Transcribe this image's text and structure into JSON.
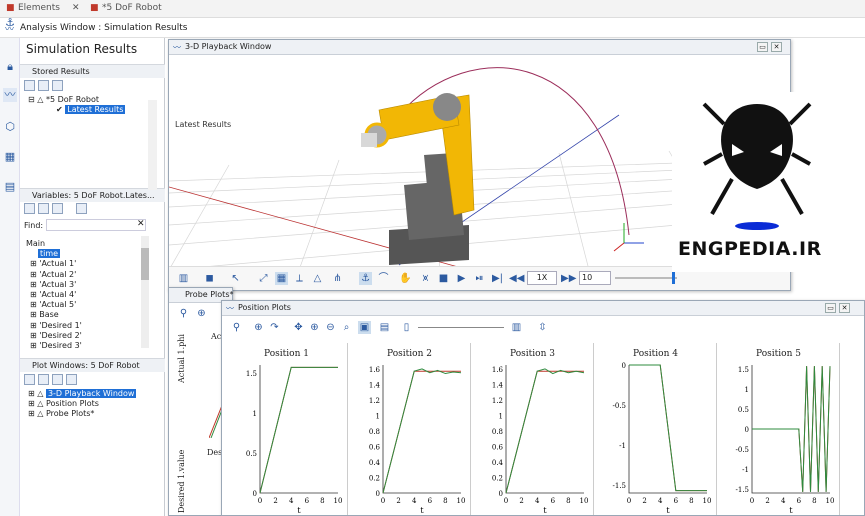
{
  "app": {
    "tab1": "Elements",
    "tab2": "*5 DoF Robot",
    "breadcrumb": "Analysis Window : Simulation Results"
  },
  "left": {
    "title": "Simulation Results",
    "stored_header": "Stored Results",
    "stored_tree": [
      "*5 DoF Robot",
      "Latest Results"
    ],
    "variables_header": "Variables: 5 DoF Robot.Lates...",
    "find_label": "Find:",
    "var_tree": [
      "Main",
      "time",
      "'Actual 1'",
      "'Actual 2'",
      "'Actual 3'",
      "'Actual 4'",
      "'Actual 5'",
      "Base",
      "'Desired 1'",
      "'Desired 2'",
      "'Desired 3'"
    ],
    "plotwin_header": "Plot Windows: 5 DoF Robot",
    "plotwin_tree": [
      "3-D Playback Window",
      "Position Plots",
      "Probe Plots*"
    ]
  },
  "playback": {
    "title": "3-D Playback Window",
    "scene_label": "Latest Results",
    "speed": "1X",
    "frame": "10",
    "frame_fraction": 0.94
  },
  "probe": {
    "title": "Probe Plots*",
    "labels": [
      "Ac",
      "Actual 1.phi",
      "Des",
      "Desired 1.value"
    ]
  },
  "position": {
    "title": "Position Plots"
  },
  "logo": {
    "text": "ENGPEDIA.IR"
  },
  "plots": [
    {
      "title": "Position 1",
      "yticks": [
        "1.5",
        "1",
        "0.5",
        "0"
      ],
      "xticks": [
        "0",
        "2",
        "4",
        "6",
        "8",
        "10"
      ],
      "xlabel": "t"
    },
    {
      "title": "Position 2",
      "yticks": [
        "1.6",
        "1.4",
        "1.2",
        "1",
        "0.8",
        "0.6",
        "0.4",
        "0.2",
        "0"
      ],
      "xticks": [
        "0",
        "2",
        "4",
        "6",
        "8",
        "10"
      ],
      "xlabel": "t"
    },
    {
      "title": "Position 3",
      "yticks": [
        "1.6",
        "1.4",
        "1.2",
        "1",
        "0.8",
        "0.6",
        "0.4",
        "0.2",
        "0"
      ],
      "xticks": [
        "0",
        "2",
        "4",
        "6",
        "8",
        "10"
      ],
      "xlabel": "t"
    },
    {
      "title": "Position 4",
      "yticks": [
        "0",
        "-0.5",
        "-1",
        "-1.5"
      ],
      "xticks": [
        "0",
        "2",
        "4",
        "6",
        "8",
        "10"
      ],
      "xlabel": "t"
    },
    {
      "title": "Position 5",
      "yticks": [
        "1.5",
        "1",
        "0.5",
        "0",
        "-0.5",
        "-1",
        "-1.5"
      ],
      "xticks": [
        "0",
        "2",
        "4",
        "6",
        "8",
        "10"
      ],
      "xlabel": "t"
    }
  ],
  "colors": {
    "accent": "#1f6fd6",
    "actual": "#2e8b3e",
    "desired": "#c0392b",
    "robot_yellow": "#f2b705"
  }
}
